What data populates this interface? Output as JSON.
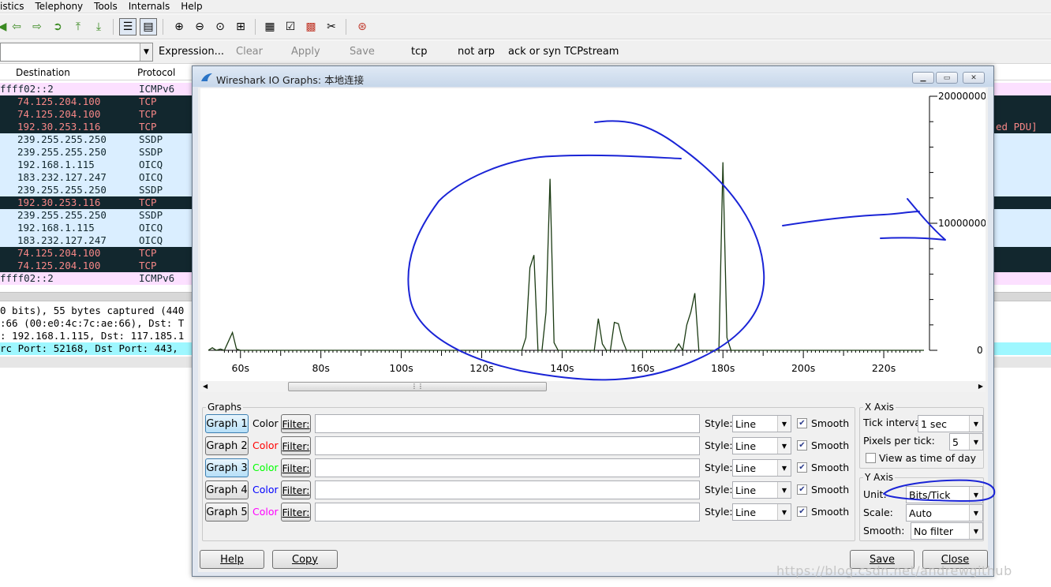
{
  "menu": [
    "istics",
    "Telephony",
    "Tools",
    "Internals",
    "Help"
  ],
  "filter_toolbar": {
    "expression": "Expression...",
    "clear": "Clear",
    "apply": "Apply",
    "save": "Save",
    "buttons": [
      "tcp",
      "not arp",
      "ack or syn",
      "TCPstream"
    ]
  },
  "packet_list": {
    "headers": {
      "destination": "Destination",
      "protocol": "Protocol"
    },
    "rows": [
      {
        "dst": "ffff02::2",
        "proto": "ICMPv6",
        "style": "pink",
        "info": ""
      },
      {
        "dst": "74.125.204.100",
        "proto": "TCP",
        "style": "dark",
        "info": ""
      },
      {
        "dst": "74.125.204.100",
        "proto": "TCP",
        "style": "dark",
        "info": ""
      },
      {
        "dst": "192.30.253.116",
        "proto": "TCP",
        "style": "dark",
        "info": "ed PDU]"
      },
      {
        "dst": "239.255.255.250",
        "proto": "SSDP",
        "style": "blue",
        "info": ""
      },
      {
        "dst": "239.255.255.250",
        "proto": "SSDP",
        "style": "blue",
        "info": ""
      },
      {
        "dst": "192.168.1.115",
        "proto": "OICQ",
        "style": "blue",
        "info": ""
      },
      {
        "dst": "183.232.127.247",
        "proto": "OICQ",
        "style": "blue",
        "info": ""
      },
      {
        "dst": "239.255.255.250",
        "proto": "SSDP",
        "style": "blue",
        "info": ""
      },
      {
        "dst": "192.30.253.116",
        "proto": "TCP",
        "style": "dark",
        "info": ""
      },
      {
        "dst": "239.255.255.250",
        "proto": "SSDP",
        "style": "blue",
        "info": ""
      },
      {
        "dst": "192.168.1.115",
        "proto": "OICQ",
        "style": "blue",
        "info": ""
      },
      {
        "dst": "183.232.127.247",
        "proto": "OICQ",
        "style": "blue",
        "info": ""
      },
      {
        "dst": "74.125.204.100",
        "proto": "TCP",
        "style": "dark",
        "info": ""
      },
      {
        "dst": "74.125.204.100",
        "proto": "TCP",
        "style": "dark",
        "info": ""
      },
      {
        "dst": "ffff02::2",
        "proto": "ICMPv6",
        "style": "pink",
        "info": ""
      }
    ]
  },
  "details": [
    "0 bits), 55 bytes captured (440",
    ":66 (00:e0:4c:7c:ae:66), Dst: T",
    ": 192.168.1.115, Dst: 117.185.1",
    "rc Port: 52168, Dst Port: 443,"
  ],
  "dialog": {
    "title": "Wireshark IO Graphs: 本地连接",
    "graphs_caption": "Graphs",
    "color_label": "Color",
    "filter_label": "Filter:",
    "style_label": "Style:",
    "smooth_label": "Smooth",
    "graphs": [
      {
        "name": "Graph 1",
        "color": "#000000",
        "active": true,
        "style": "Line",
        "smooth": true,
        "filter": ""
      },
      {
        "name": "Graph 2",
        "color": "#ff0000",
        "active": false,
        "style": "Line",
        "smooth": true,
        "filter": ""
      },
      {
        "name": "Graph 3",
        "color": "#00ff00",
        "active": true,
        "style": "Line",
        "smooth": true,
        "filter": ""
      },
      {
        "name": "Graph 4",
        "color": "#0000ff",
        "active": false,
        "style": "Line",
        "smooth": true,
        "filter": ""
      },
      {
        "name": "Graph 5",
        "color": "#ff00ff",
        "active": false,
        "style": "Line",
        "smooth": true,
        "filter": ""
      }
    ],
    "x_axis": {
      "caption": "X Axis",
      "tick_interval_label": "Tick interval:",
      "tick_interval": "1 sec",
      "pixels_per_tick_label": "Pixels per tick:",
      "pixels_per_tick": "5",
      "time_of_day_label": "View as time of day",
      "time_of_day": false
    },
    "y_axis": {
      "caption": "Y Axis",
      "unit_label": "Unit:",
      "unit": "Bits/Tick",
      "scale_label": "Scale:",
      "scale": "Auto",
      "smooth_label": "Smooth:",
      "smooth": "No filter"
    },
    "buttons": {
      "help": "Help",
      "copy": "Copy",
      "save": "Save",
      "close": "Close"
    }
  },
  "chart_data": {
    "type": "line",
    "color": "#1a3a12",
    "x_ticks": [
      "60s",
      "80s",
      "100s",
      "120s",
      "140s",
      "160s",
      "180s",
      "200s",
      "220s"
    ],
    "y_ticks": [
      "20000000",
      "10000000",
      "0"
    ],
    "ylim": [
      0,
      20000000
    ],
    "xlim": [
      52,
      230
    ],
    "series": [
      {
        "x": [
          52,
          53,
          54,
          55,
          56,
          57,
          58,
          59,
          60,
          61,
          62,
          66,
          70,
          75,
          80,
          85,
          90,
          95,
          100,
          105,
          110,
          115,
          120,
          125,
          126,
          127,
          128,
          129,
          130,
          131,
          132,
          133,
          134,
          135,
          136,
          137,
          138,
          139,
          140,
          141,
          145,
          146,
          147,
          148,
          149,
          150,
          151,
          152,
          153,
          154,
          155,
          156,
          160,
          164,
          165,
          166,
          167,
          168,
          169,
          170,
          171,
          172,
          173,
          174,
          175,
          176,
          177,
          178,
          179,
          180,
          181,
          182,
          183,
          190,
          200,
          210,
          220,
          225,
          226,
          227,
          230
        ],
        "y": [
          0,
          200000,
          0,
          100000,
          0,
          700000,
          1400000,
          100000,
          0,
          0,
          0,
          0,
          0,
          0,
          0,
          0,
          0,
          0,
          0,
          0,
          0,
          0,
          0,
          0,
          0,
          0,
          0,
          0,
          0,
          1000000,
          6500000,
          7500000,
          0,
          0,
          3000000,
          13500000,
          600000,
          0,
          0,
          0,
          0,
          0,
          0,
          0,
          2500000,
          500000,
          0,
          0,
          2200000,
          2100000,
          800000,
          0,
          0,
          0,
          0,
          0,
          0,
          0,
          500000,
          0,
          2000000,
          3000000,
          4500000,
          0,
          0,
          0,
          0,
          0,
          0,
          14800000,
          1000000,
          0,
          0,
          0,
          0,
          0,
          0,
          0,
          0,
          0,
          0
        ]
      }
    ]
  },
  "watermark": "https://blog.csdn.net/andrewgithub"
}
